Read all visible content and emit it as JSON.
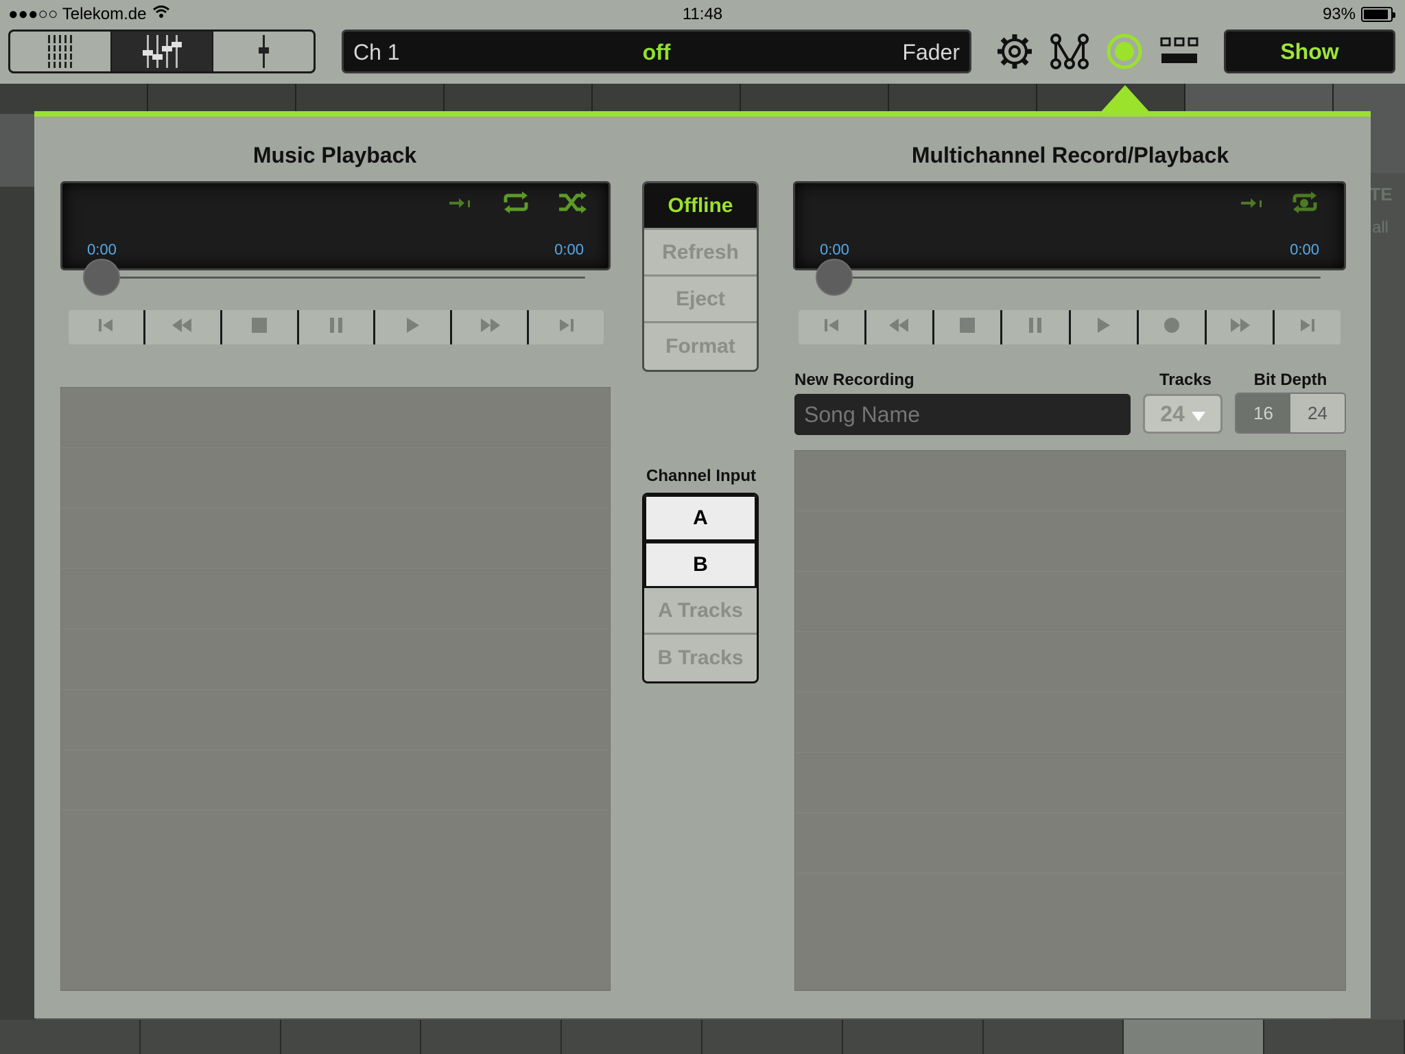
{
  "status_bar": {
    "carrier": "●●●○○ Telekom.de",
    "time": "11:48",
    "battery": "93%",
    "battery_level": 0.93
  },
  "toolbar": {
    "channel": "Ch 1",
    "state": "off",
    "mode": "Fader",
    "show_label": "Show",
    "icons": [
      "settings-icon",
      "routing-icon",
      "record-icon",
      "layout-icon"
    ]
  },
  "background": {
    "mute_label": "MUTE",
    "all_label": "all"
  },
  "music_playback": {
    "title": "Music Playback",
    "time_start": "0:00",
    "time_end": "0:00",
    "position": 0,
    "transport": [
      "skip-back",
      "rewind",
      "stop",
      "pause",
      "play",
      "fast-forward",
      "skip-forward"
    ],
    "list_rows": 7
  },
  "media_controls": {
    "offline": "Offline",
    "refresh": "Refresh",
    "eject": "Eject",
    "format": "Format"
  },
  "channel_input": {
    "title": "Channel Input",
    "a": "A",
    "b": "B",
    "a_tracks": "A Tracks",
    "b_tracks": "B Tracks"
  },
  "multichannel": {
    "title": "Multichannel Record/Playback",
    "time_start": "0:00",
    "time_end": "0:00",
    "position": 0,
    "transport": [
      "skip-back",
      "rewind",
      "stop",
      "pause",
      "play",
      "record",
      "fast-forward",
      "skip-forward"
    ],
    "new_recording_label": "New Recording",
    "song_placeholder": "Song Name",
    "tracks_label": "Tracks",
    "tracks_value": "24",
    "bit_depth_label": "Bit Depth",
    "bit_depth_options": [
      "16",
      "24"
    ],
    "bit_depth_selected": "16"
  },
  "colors": {
    "accent_green": "#9ae22b",
    "time_blue": "#58a9e6",
    "panel": "#a1a69e"
  }
}
